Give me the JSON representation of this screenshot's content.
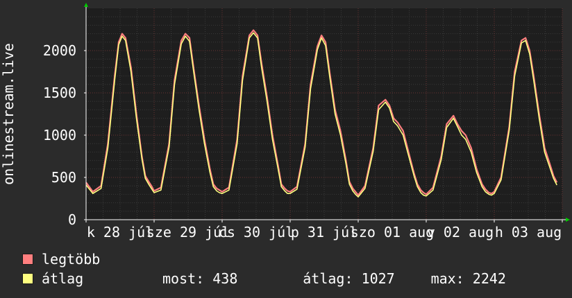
{
  "colors": {
    "background": "#2b2b2b",
    "plot_background": "#1e1e1e",
    "grid": "#4a4a4a",
    "axis": "#ffffff",
    "series_max": "#ff7f7f",
    "series_avg": "#ffff80",
    "arrow": "#00cc00"
  },
  "legend": {
    "max_label": "legtöbb",
    "avg_label": "átlag",
    "stats": {
      "now_label": "most:",
      "now_value": "438",
      "avg_label": "átlag:",
      "avg_value": "1027",
      "max_label": "max:",
      "max_value": "2242"
    }
  },
  "chart_data": {
    "type": "line",
    "ylabel": "onlinestream.live",
    "ylim": [
      0,
      2500
    ],
    "yticks": [
      0,
      500,
      1000,
      1500,
      2000
    ],
    "xlim": [
      0,
      7
    ],
    "x_tick_labels": [
      "k 28 júl",
      "sze 29 júl",
      "cs 30 júl",
      "p 31 júl",
      "szo 01 aug",
      "v 02 aug",
      "h 03 aug"
    ],
    "grid": true,
    "series": [
      {
        "name": "legtöbb",
        "color": "#ff7f7f",
        "x": [
          0,
          0.1,
          0.22,
          0.32,
          0.42,
          0.48,
          0.53,
          0.58,
          0.66,
          0.74,
          0.82,
          0.87,
          0.92,
          0.96,
          1.0,
          1.1,
          1.22,
          1.3,
          1.4,
          1.46,
          1.52,
          1.58,
          1.66,
          1.74,
          1.82,
          1.87,
          1.92,
          1.96,
          2.0,
          2.1,
          2.22,
          2.3,
          2.4,
          2.46,
          2.52,
          2.58,
          2.66,
          2.74,
          2.82,
          2.87,
          2.92,
          2.96,
          3.0,
          3.1,
          3.22,
          3.3,
          3.4,
          3.46,
          3.52,
          3.58,
          3.66,
          3.74,
          3.82,
          3.87,
          3.92,
          3.96,
          4.0,
          4.1,
          4.22,
          4.3,
          4.4,
          4.46,
          4.52,
          4.58,
          4.66,
          4.74,
          4.82,
          4.87,
          4.92,
          4.96,
          5.0,
          5.1,
          5.22,
          5.3,
          5.4,
          5.46,
          5.52,
          5.58,
          5.66,
          5.74,
          5.82,
          5.87,
          5.92,
          5.96,
          6.0,
          6.1,
          6.22,
          6.3,
          6.4,
          6.46,
          6.52,
          6.58,
          6.66,
          6.74,
          6.82,
          6.87,
          6.92
        ],
        "values": [
          440,
          330,
          400,
          900,
          1700,
          2100,
          2200,
          2150,
          1800,
          1250,
          750,
          520,
          450,
          400,
          340,
          380,
          900,
          1650,
          2120,
          2200,
          2150,
          1800,
          1350,
          950,
          600,
          420,
          370,
          350,
          330,
          380,
          950,
          1700,
          2180,
          2242,
          2180,
          1850,
          1450,
          1000,
          650,
          420,
          370,
          340,
          330,
          390,
          900,
          1600,
          2050,
          2180,
          2100,
          1750,
          1300,
          1050,
          700,
          450,
          370,
          330,
          290,
          400,
          850,
          1350,
          1420,
          1350,
          1200,
          1150,
          1050,
          800,
          550,
          420,
          350,
          320,
          300,
          380,
          750,
          1130,
          1230,
          1130,
          1050,
          1000,
          850,
          600,
          420,
          360,
          320,
          310,
          330,
          500,
          1100,
          1750,
          2120,
          2150,
          2000,
          1700,
          1250,
          850,
          650,
          520,
          440
        ]
      },
      {
        "name": "átlag",
        "color": "#ffff80",
        "x": [
          0,
          0.1,
          0.22,
          0.32,
          0.42,
          0.48,
          0.53,
          0.58,
          0.66,
          0.74,
          0.82,
          0.87,
          0.92,
          0.96,
          1.0,
          1.1,
          1.22,
          1.3,
          1.4,
          1.46,
          1.52,
          1.58,
          1.66,
          1.74,
          1.82,
          1.87,
          1.92,
          1.96,
          2.0,
          2.1,
          2.22,
          2.3,
          2.4,
          2.46,
          2.52,
          2.58,
          2.66,
          2.74,
          2.82,
          2.87,
          2.92,
          2.96,
          3.0,
          3.1,
          3.22,
          3.3,
          3.4,
          3.46,
          3.52,
          3.58,
          3.66,
          3.74,
          3.82,
          3.87,
          3.92,
          3.96,
          4.0,
          4.1,
          4.22,
          4.3,
          4.4,
          4.46,
          4.52,
          4.58,
          4.66,
          4.74,
          4.82,
          4.87,
          4.92,
          4.96,
          5.0,
          5.1,
          5.22,
          5.3,
          5.4,
          5.46,
          5.52,
          5.58,
          5.66,
          5.74,
          5.82,
          5.87,
          5.92,
          5.96,
          6.0,
          6.1,
          6.22,
          6.3,
          6.4,
          6.46,
          6.52,
          6.58,
          6.66,
          6.74,
          6.82,
          6.87,
          6.92
        ],
        "values": [
          410,
          310,
          370,
          850,
          1650,
          2070,
          2170,
          2120,
          1750,
          1200,
          720,
          490,
          420,
          370,
          320,
          350,
          860,
          1600,
          2080,
          2170,
          2110,
          1760,
          1300,
          900,
          560,
          390,
          340,
          320,
          310,
          350,
          900,
          1650,
          2150,
          2210,
          2150,
          1800,
          1400,
          950,
          610,
          390,
          340,
          310,
          310,
          360,
          860,
          1550,
          2010,
          2150,
          2060,
          1700,
          1250,
          1000,
          660,
          420,
          340,
          300,
          270,
          370,
          810,
          1300,
          1390,
          1320,
          1160,
          1110,
          1000,
          760,
          520,
          390,
          320,
          290,
          280,
          350,
          710,
          1090,
          1200,
          1100,
          1000,
          950,
          800,
          560,
          390,
          330,
          300,
          290,
          310,
          470,
          1060,
          1700,
          2090,
          2120,
          1960,
          1650,
          1200,
          800,
          610,
          490,
          410
        ]
      }
    ]
  }
}
